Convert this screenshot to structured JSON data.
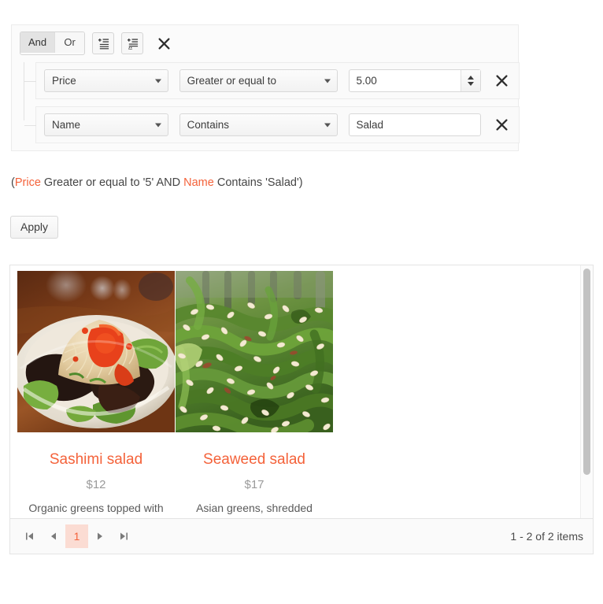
{
  "filter_builder": {
    "logic": {
      "and_label": "And",
      "or_label": "Or",
      "selected": "And"
    },
    "actions": {
      "add_filter_icon": "add-filter-icon",
      "add_group_icon": "add-group-icon",
      "remove_group_icon": "close-icon"
    },
    "rows": [
      {
        "field": "Price",
        "operator": "Greater or equal to",
        "value": "5.00",
        "value_type": "numeric",
        "remove_icon": "close-icon"
      },
      {
        "field": "Name",
        "operator": "Contains",
        "value": "Salad",
        "value_type": "text",
        "remove_icon": "close-icon"
      }
    ]
  },
  "expression": {
    "open_paren": "(",
    "field1": "Price",
    "mid1": " Greater or equal to '5' AND ",
    "field2": "Name",
    "mid2": " Contains 'Salad'",
    "close_paren": ")"
  },
  "apply": {
    "label": "Apply"
  },
  "listview": {
    "items": [
      {
        "title": "Sashimi salad",
        "price": "$12",
        "description": "Organic greens topped with",
        "image": "sashimi-salad-photo"
      },
      {
        "title": "Seaweed salad",
        "price": "$17",
        "description": "Asian greens, shredded",
        "image": "seaweed-salad-photo"
      }
    ]
  },
  "pager": {
    "first_icon": "first-page-icon",
    "prev_icon": "previous-page-icon",
    "next_icon": "next-page-icon",
    "last_icon": "last-page-icon",
    "pages": [
      "1"
    ],
    "current_page": "1",
    "info": "1 - 2 of 2 items"
  },
  "colors": {
    "accent": "#f4623a",
    "accent_bg": "#fbdcd3",
    "panel_border": "#e4e4e4"
  }
}
